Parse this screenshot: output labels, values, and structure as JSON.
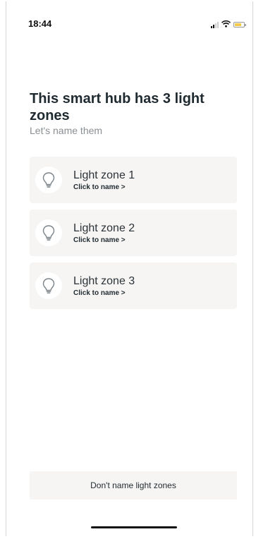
{
  "status_bar": {
    "time": "18:44",
    "icons": [
      "signal-icon",
      "wifi-icon",
      "battery-charging-icon"
    ]
  },
  "header": {
    "title": "This smart hub has 3 light zones",
    "subtitle": "Let's name them"
  },
  "zones": [
    {
      "name": "Light zone 1",
      "action": "Click to name >",
      "icon": "lightbulb-icon"
    },
    {
      "name": "Light zone 2",
      "action": "Click to name >",
      "icon": "lightbulb-icon"
    },
    {
      "name": "Light zone 3",
      "action": "Click to name >",
      "icon": "lightbulb-icon"
    }
  ],
  "footer": {
    "skip_label": "Don't name light zones"
  },
  "colors": {
    "text": "#1f2a30",
    "muted": "#8a8f93",
    "card": "#f6f5f4",
    "battery": "#f2c94c"
  }
}
